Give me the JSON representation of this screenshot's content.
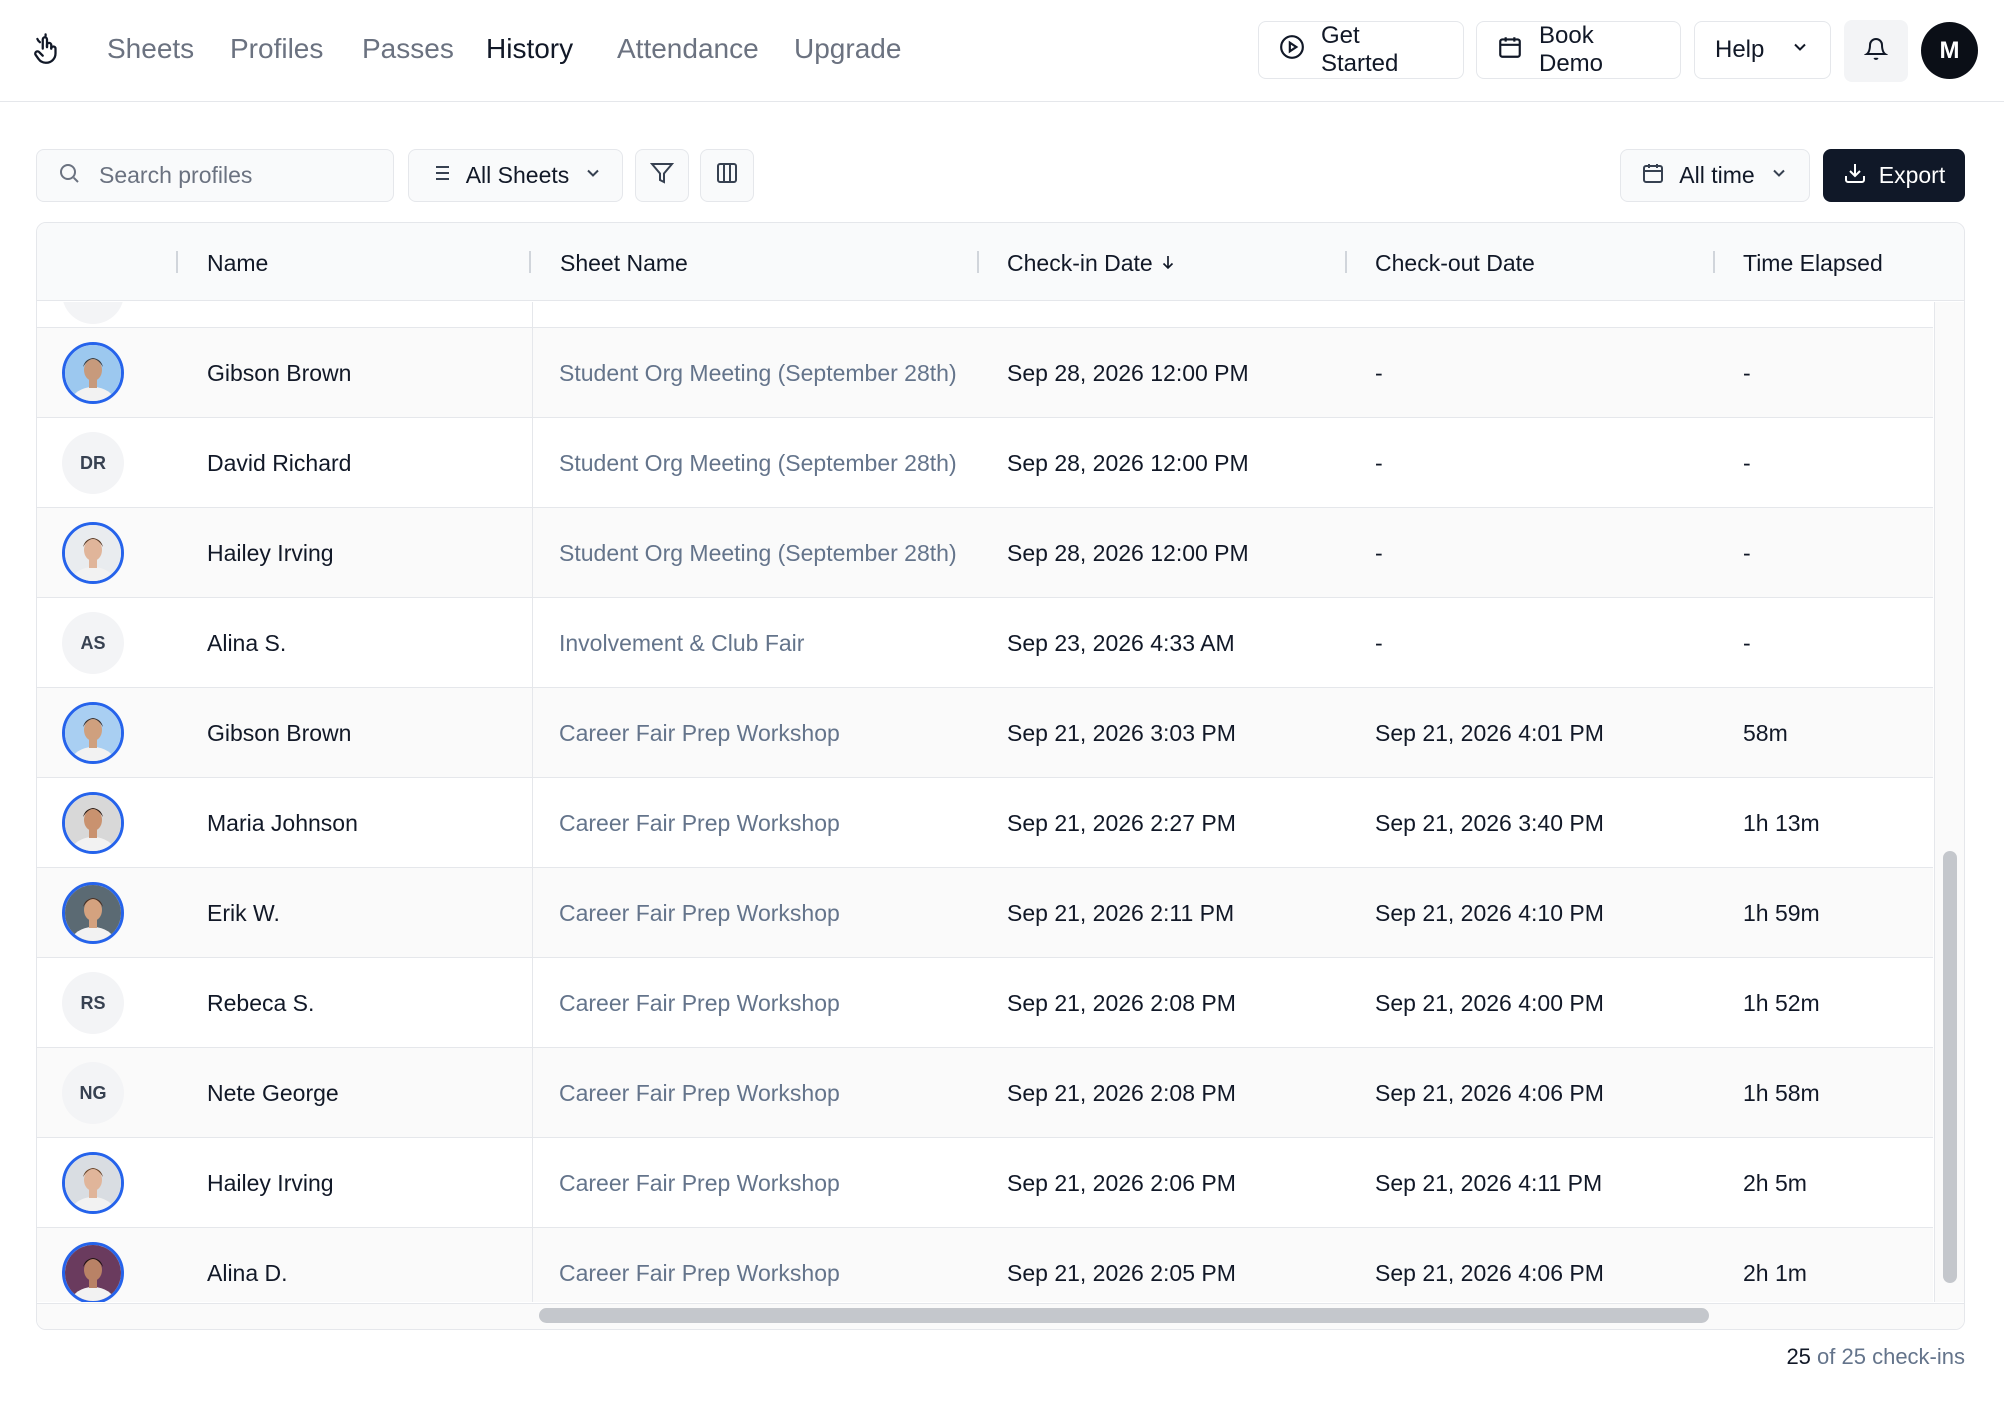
{
  "nav": {
    "links": [
      "Sheets",
      "Profiles",
      "Passes",
      "History",
      "Attendance",
      "Upgrade"
    ],
    "active": "History",
    "get_started": "Get Started",
    "book_demo": "Book Demo",
    "help": "Help",
    "user_initial": "M"
  },
  "toolbar": {
    "search_placeholder": "Search profiles",
    "sheets_filter": "All Sheets",
    "date_range": "All time",
    "export": "Export"
  },
  "table": {
    "headers": {
      "name": "Name",
      "sheet": "Sheet Name",
      "checkin": "Check-in Date",
      "checkout": "Check-out Date",
      "elapsed": "Time Elapsed"
    },
    "sort_indicator": "arrow-down-icon",
    "rows": [
      {
        "avatar": "photo",
        "initials": "",
        "name": "Gibson Brown",
        "sheet": "Student Org Meeting (September 28th)",
        "checkin": "Sep 28, 2026 12:00 PM",
        "checkout": "-",
        "elapsed": "-"
      },
      {
        "avatar": "initials",
        "initials": "DR",
        "name": "David Richard",
        "sheet": "Student Org Meeting (September 28th)",
        "checkin": "Sep 28, 2026 12:00 PM",
        "checkout": "-",
        "elapsed": "-"
      },
      {
        "avatar": "photo",
        "initials": "",
        "name": "Hailey Irving",
        "sheet": "Student Org Meeting (September 28th)",
        "checkin": "Sep 28, 2026 12:00 PM",
        "checkout": "-",
        "elapsed": "-"
      },
      {
        "avatar": "initials",
        "initials": "AS",
        "name": "Alina S.",
        "sheet": "Involvement & Club Fair",
        "checkin": "Sep 23, 2026 4:33 AM",
        "checkout": "-",
        "elapsed": "-"
      },
      {
        "avatar": "photo",
        "initials": "",
        "name": "Gibson Brown",
        "sheet": "Career Fair Prep Workshop",
        "checkin": "Sep 21, 2026 3:03 PM",
        "checkout": "Sep 21, 2026 4:01 PM",
        "elapsed": "58m"
      },
      {
        "avatar": "photo",
        "initials": "",
        "name": "Maria Johnson",
        "sheet": "Career Fair Prep Workshop",
        "checkin": "Sep 21, 2026 2:27 PM",
        "checkout": "Sep 21, 2026 3:40 PM",
        "elapsed": "1h 13m"
      },
      {
        "avatar": "photo",
        "initials": "",
        "name": "Erik W.",
        "sheet": "Career Fair Prep Workshop",
        "checkin": "Sep 21, 2026 2:11 PM",
        "checkout": "Sep 21, 2026 4:10 PM",
        "elapsed": "1h 59m"
      },
      {
        "avatar": "initials",
        "initials": "RS",
        "name": "Rebeca S.",
        "sheet": "Career Fair Prep Workshop",
        "checkin": "Sep 21, 2026 2:08 PM",
        "checkout": "Sep 21, 2026 4:00 PM",
        "elapsed": "1h 52m"
      },
      {
        "avatar": "initials",
        "initials": "NG",
        "name": "Nete George",
        "sheet": "Career Fair Prep Workshop",
        "checkin": "Sep 21, 2026 2:08 PM",
        "checkout": "Sep 21, 2026 4:06 PM",
        "elapsed": "1h 58m"
      },
      {
        "avatar": "photo",
        "initials": "",
        "name": "Hailey Irving",
        "sheet": "Career Fair Prep Workshop",
        "checkin": "Sep 21, 2026 2:06 PM",
        "checkout": "Sep 21, 2026 4:11 PM",
        "elapsed": "2h 5m"
      },
      {
        "avatar": "photo",
        "initials": "",
        "name": "Alina D.",
        "sheet": "Career Fair Prep Workshop",
        "checkin": "Sep 21, 2026 2:05 PM",
        "checkout": "Sep 21, 2026 4:06 PM",
        "elapsed": "2h 1m"
      }
    ]
  },
  "footer": {
    "shown": "25",
    "suffix": " of 25 check-ins"
  },
  "colors": {
    "primary_dark": "#101828",
    "muted_text": "#6b7280",
    "sheet_link": "#64748b",
    "avatar_ring": "#2563eb"
  }
}
